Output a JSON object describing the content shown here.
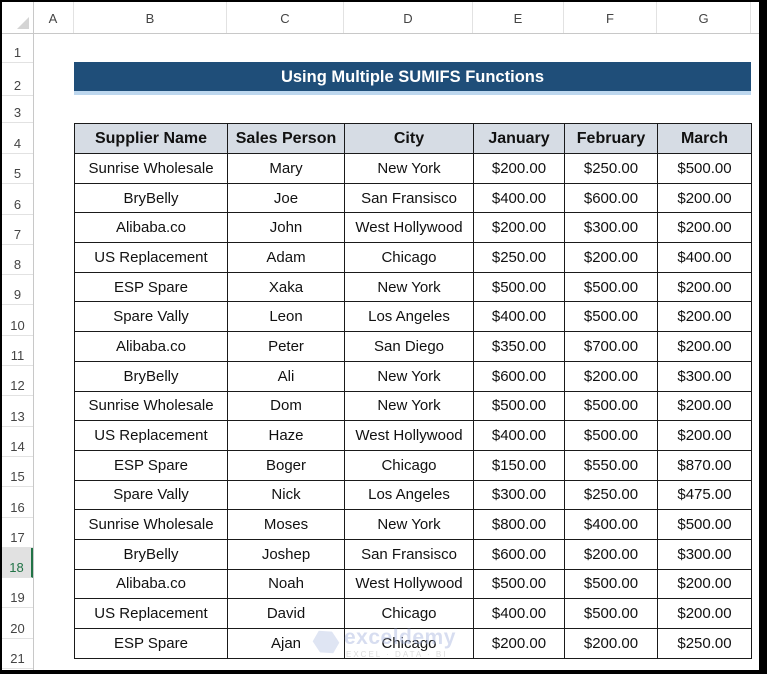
{
  "sheet": {
    "columns": [
      "A",
      "B",
      "C",
      "D",
      "E",
      "F",
      "G"
    ],
    "rows": [
      "1",
      "2",
      "3",
      "4",
      "5",
      "6",
      "7",
      "8",
      "9",
      "10",
      "11",
      "12",
      "13",
      "14",
      "15",
      "16",
      "17",
      "18",
      "19",
      "20",
      "21"
    ],
    "selected_row": "18"
  },
  "title": "Using Multiple SUMIFS Functions",
  "table": {
    "headers": [
      "Supplier Name",
      "Sales Person",
      "City",
      "January",
      "February",
      "March"
    ],
    "rows": [
      [
        "Sunrise Wholesale",
        "Mary",
        "New York",
        "$200.00",
        "$250.00",
        "$500.00"
      ],
      [
        "BryBelly",
        "Joe",
        "San Fransisco",
        "$400.00",
        "$600.00",
        "$200.00"
      ],
      [
        "Alibaba.co",
        "John",
        "West Hollywood",
        "$200.00",
        "$300.00",
        "$200.00"
      ],
      [
        "US Replacement",
        "Adam",
        "Chicago",
        "$250.00",
        "$200.00",
        "$400.00"
      ],
      [
        "ESP Spare",
        "Xaka",
        "New York",
        "$500.00",
        "$500.00",
        "$200.00"
      ],
      [
        "Spare Vally",
        "Leon",
        "Los Angeles",
        "$400.00",
        "$500.00",
        "$200.00"
      ],
      [
        "Alibaba.co",
        "Peter",
        "San Diego",
        "$350.00",
        "$700.00",
        "$200.00"
      ],
      [
        "BryBelly",
        "Ali",
        "New York",
        "$600.00",
        "$200.00",
        "$300.00"
      ],
      [
        "Sunrise Wholesale",
        "Dom",
        "New York",
        "$500.00",
        "$500.00",
        "$200.00"
      ],
      [
        "US Replacement",
        "Haze",
        "West Hollywood",
        "$400.00",
        "$500.00",
        "$200.00"
      ],
      [
        "ESP Spare",
        "Boger",
        "Chicago",
        "$150.00",
        "$550.00",
        "$870.00"
      ],
      [
        "Spare Vally",
        "Nick",
        "Los Angeles",
        "$300.00",
        "$250.00",
        "$475.00"
      ],
      [
        "Sunrise Wholesale",
        "Moses",
        "New York",
        "$800.00",
        "$400.00",
        "$500.00"
      ],
      [
        "BryBelly",
        "Joshep",
        "San Fransisco",
        "$600.00",
        "$200.00",
        "$300.00"
      ],
      [
        "Alibaba.co",
        "Noah",
        "West Hollywood",
        "$500.00",
        "$500.00",
        "$200.00"
      ],
      [
        "US Replacement",
        "David",
        "Chicago",
        "$400.00",
        "$500.00",
        "$200.00"
      ],
      [
        "ESP Spare",
        "Ajan",
        "Chicago",
        "$200.00",
        "$200.00",
        "$250.00"
      ]
    ]
  },
  "watermark": {
    "name": "exceldemy",
    "tagline": "EXCEL · DATA · BI",
    "icon": "exceldemy-logo-icon"
  },
  "colors": {
    "title_bg": "#1f4e79",
    "title_underline": "#bdd7ee",
    "header_bg": "#d6dce4",
    "selected_row_accent": "#217346"
  }
}
